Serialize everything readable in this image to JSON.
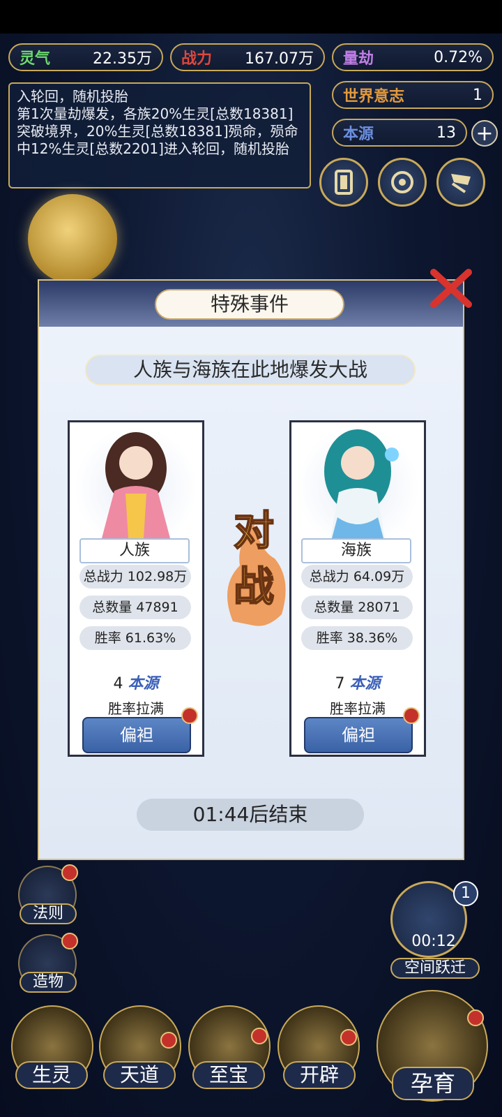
{
  "resources": {
    "lingqi": {
      "label": "灵气",
      "value": "22.35万"
    },
    "zhanli": {
      "label": "战力",
      "value": "167.07万"
    },
    "lianjie": {
      "label": "量劫",
      "value": "0.72%"
    },
    "shijieyizhi": {
      "label": "世界意志",
      "value": "1"
    },
    "benyuan": {
      "label": "本源",
      "value": "13",
      "plus": "+"
    }
  },
  "log": {
    "line1": "入轮回，随机投胎",
    "line2": "第1次量劫爆发，各族20%生灵[总数18381]突破境界，20%生灵[总数18381]殒命，殒命中12%生灵[总数2201]进入轮回，随机投胎"
  },
  "side_menu": [
    {
      "label": "法则"
    },
    {
      "label": "造物"
    }
  ],
  "bottom_nav": [
    {
      "label": "生灵"
    },
    {
      "label": "天道"
    },
    {
      "label": "至宝"
    },
    {
      "label": "开辟"
    },
    {
      "label": "孕育"
    }
  ],
  "space_jump": {
    "label": "空间跃迁",
    "timer": "00:12",
    "badge": "1"
  },
  "dialog": {
    "title": "特殊事件",
    "description": "人族与海族在此地爆发大战",
    "vs_text_1": "对",
    "vs_text_2": "战",
    "timer": "01:44后结束",
    "left": {
      "name": "人族",
      "power": "总战力 102.98万",
      "count": "总数量 47891",
      "winrate": "胜率 61.63%",
      "reward_num": "4",
      "reward_word": "本源",
      "max_text": "胜率拉满",
      "button": "偏袒"
    },
    "right": {
      "name": "海族",
      "power": "总战力 64.09万",
      "count": "总数量 28071",
      "winrate": "胜率 38.36%",
      "reward_num": "7",
      "reward_word": "本源",
      "max_text": "胜率拉满",
      "button": "偏袒"
    }
  },
  "colors": {
    "gold": "#c9a95a",
    "lingqi": "#6fd86f",
    "zhanli": "#e0473b",
    "lianjie": "#c07ee6",
    "world": "#e39a3c",
    "benyuan": "#6c8fe0",
    "vs": "#f2a23a"
  }
}
